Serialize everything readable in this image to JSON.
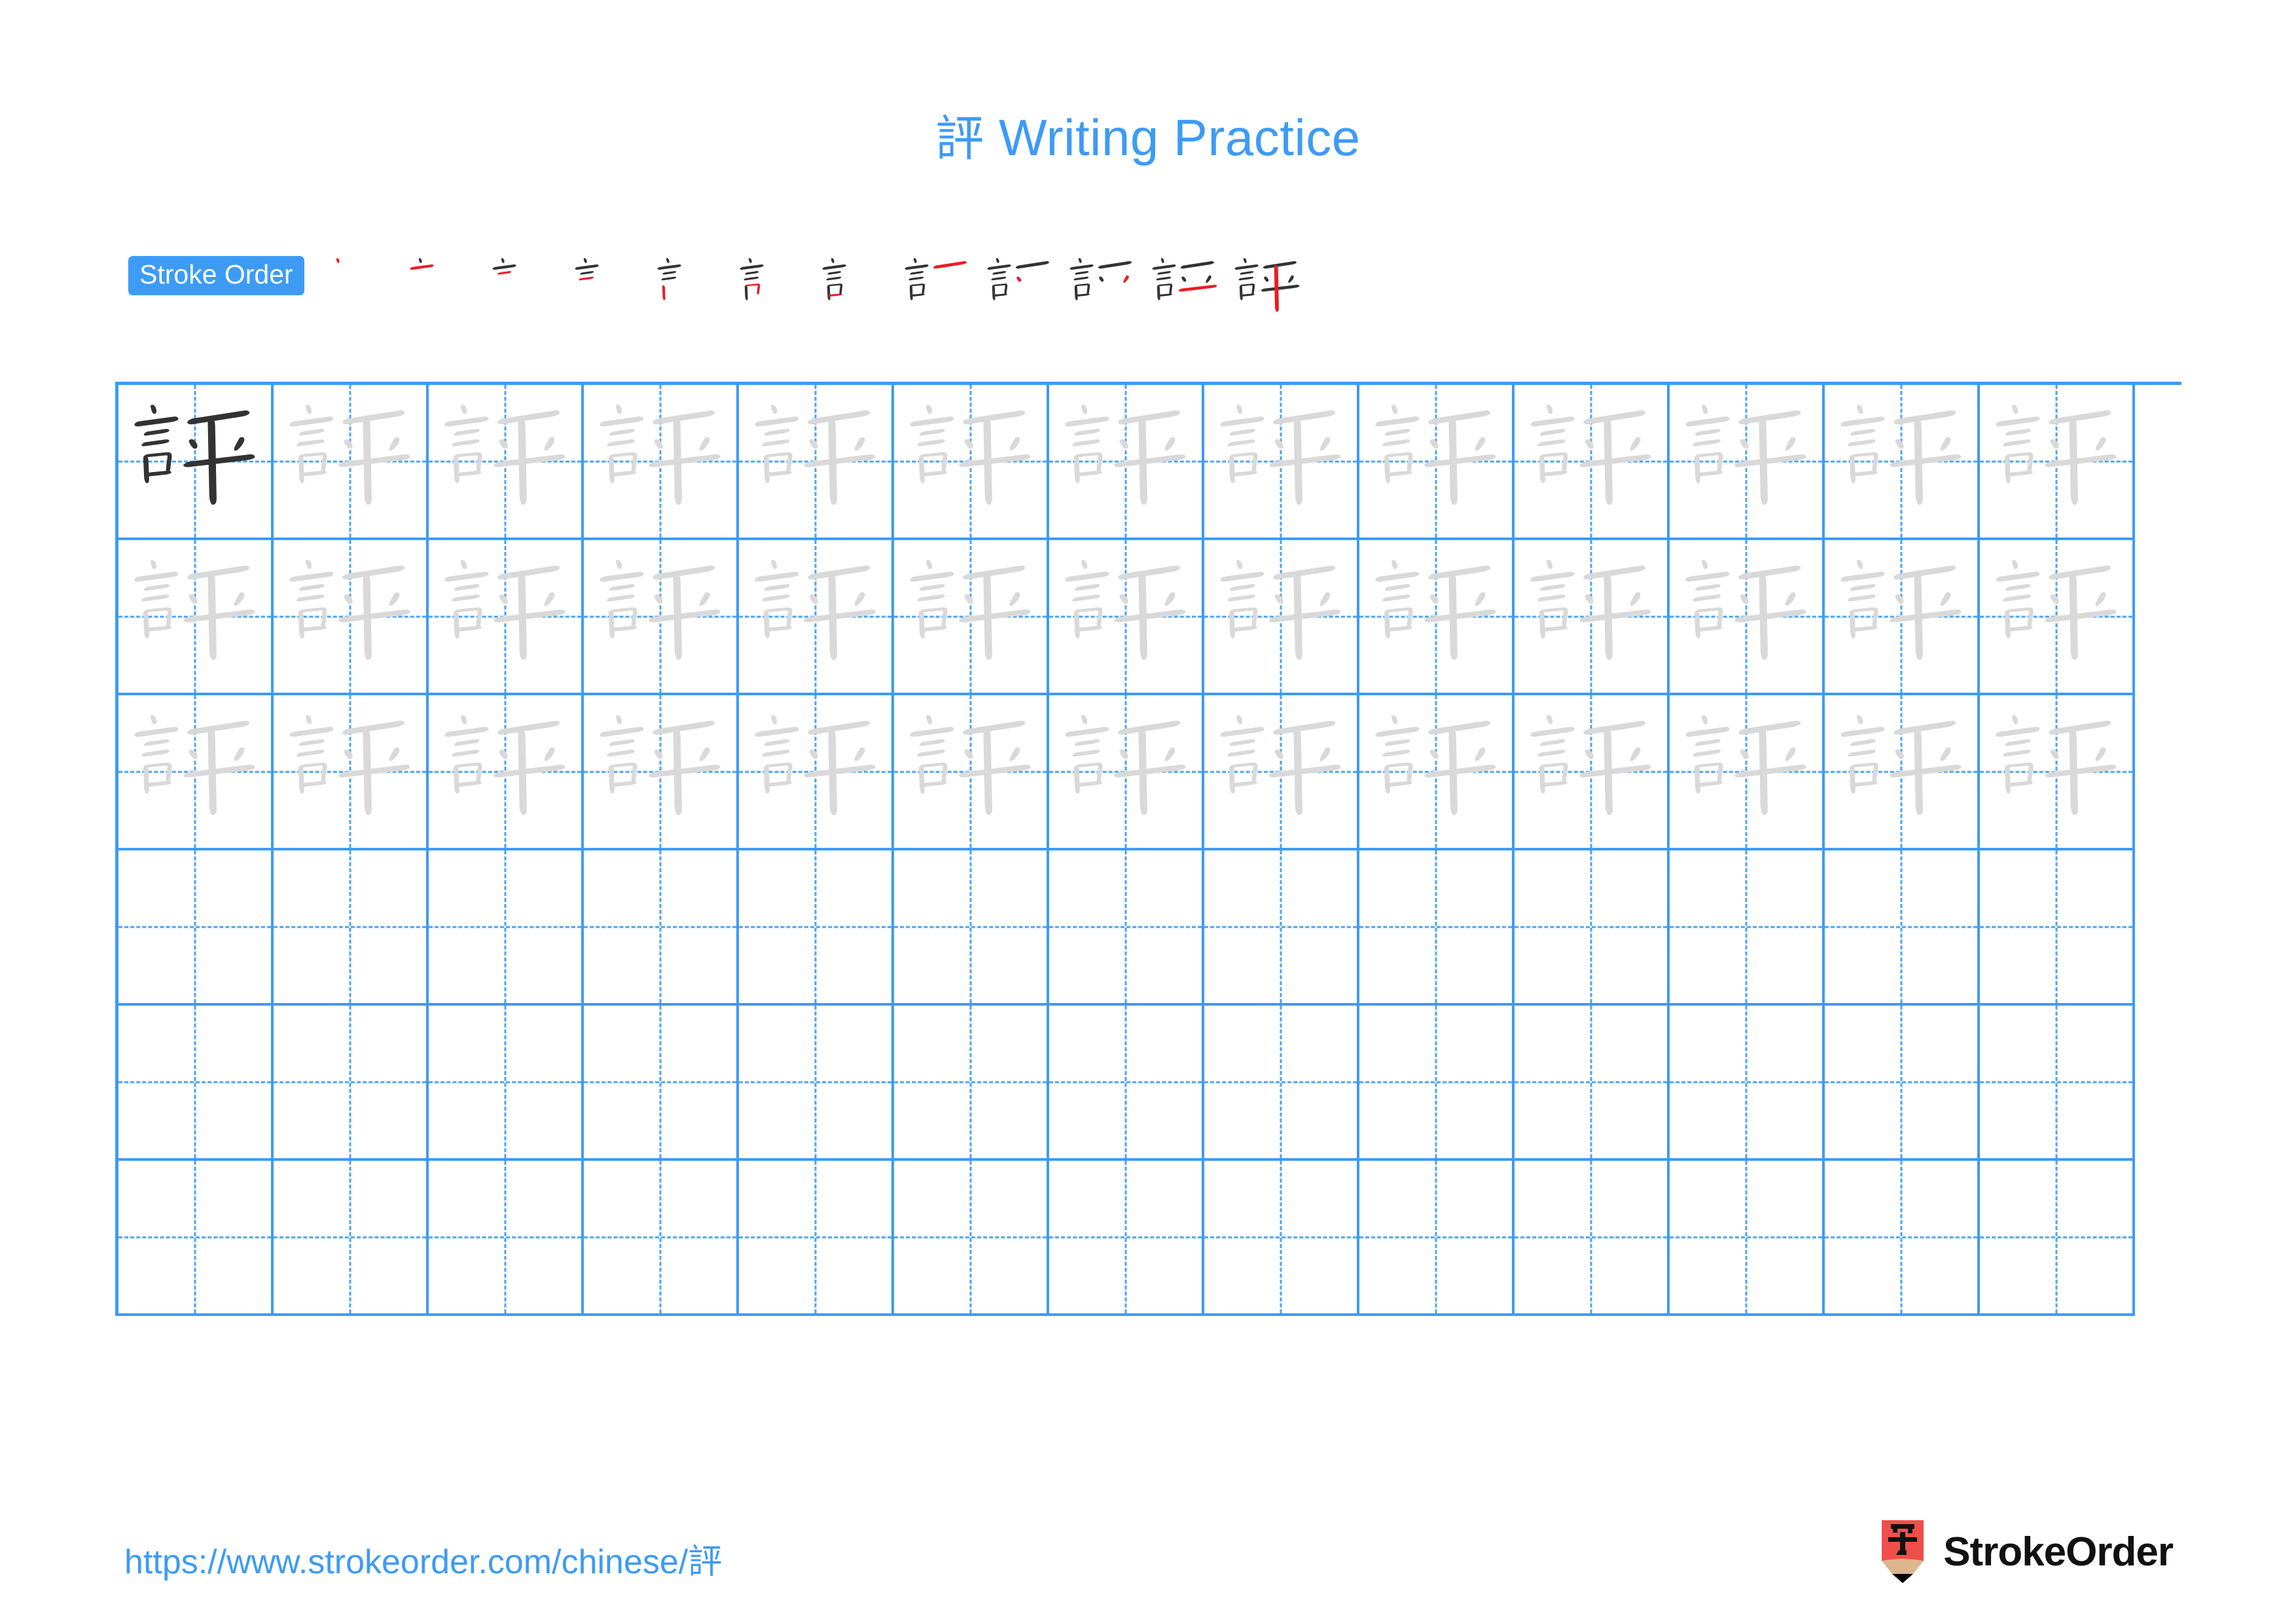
{
  "character": "評",
  "title": {
    "char": "評",
    "suffix": " Writing Practice",
    "full": "評 Writing Practice",
    "color": "#3d9bf5"
  },
  "stroke_order": {
    "badge_label": "Stroke Order",
    "badge_bg": "#3d9bf5",
    "badge_text_color": "#ffffff",
    "total_strokes": 12,
    "new_stroke_color": "#ec1c24",
    "done_stroke_color": "#333333",
    "steps": [
      {
        "index": 1,
        "strokes_drawn": 1,
        "new_stroke": 1,
        "partial": "丶"
      },
      {
        "index": 2,
        "strokes_drawn": 2,
        "new_stroke": 2,
        "partial": "二"
      },
      {
        "index": 3,
        "strokes_drawn": 3,
        "new_stroke": 3,
        "partial": "三"
      },
      {
        "index": 4,
        "strokes_drawn": 4,
        "new_stroke": 4,
        "partial": "亖"
      },
      {
        "index": 5,
        "strokes_drawn": 5,
        "new_stroke": 5,
        "partial": "訁"
      },
      {
        "index": 6,
        "strokes_drawn": 6,
        "new_stroke": 6,
        "partial": "訁"
      },
      {
        "index": 7,
        "strokes_drawn": 7,
        "new_stroke": 7,
        "partial": "言"
      },
      {
        "index": 8,
        "strokes_drawn": 8,
        "new_stroke": 8,
        "partial": "言一"
      },
      {
        "index": 9,
        "strokes_drawn": 9,
        "new_stroke": 9,
        "partial": "言丷"
      },
      {
        "index": 10,
        "strokes_drawn": 10,
        "new_stroke": 10,
        "partial": "言丷"
      },
      {
        "index": 11,
        "strokes_drawn": 11,
        "new_stroke": 11,
        "partial": "評"
      },
      {
        "index": 12,
        "strokes_drawn": 12,
        "new_stroke": 12,
        "partial": "評"
      }
    ]
  },
  "grid": {
    "columns": 13,
    "rows": 6,
    "filled_rows": 3,
    "blank_rows": 3,
    "line_color": "#3d9bf5",
    "guide_color": "#4aa3f7",
    "model_char_color": "#333333",
    "trace_char_color": "#d9d9d9",
    "cells": [
      [
        "model",
        "trace",
        "trace",
        "trace",
        "trace",
        "trace",
        "trace",
        "trace",
        "trace",
        "trace",
        "trace",
        "trace",
        "trace"
      ],
      [
        "trace",
        "trace",
        "trace",
        "trace",
        "trace",
        "trace",
        "trace",
        "trace",
        "trace",
        "trace",
        "trace",
        "trace",
        "trace"
      ],
      [
        "trace",
        "trace",
        "trace",
        "trace",
        "trace",
        "trace",
        "trace",
        "trace",
        "trace",
        "trace",
        "trace",
        "trace",
        "trace"
      ],
      [
        "empty",
        "empty",
        "empty",
        "empty",
        "empty",
        "empty",
        "empty",
        "empty",
        "empty",
        "empty",
        "empty",
        "empty",
        "empty"
      ],
      [
        "empty",
        "empty",
        "empty",
        "empty",
        "empty",
        "empty",
        "empty",
        "empty",
        "empty",
        "empty",
        "empty",
        "empty",
        "empty"
      ],
      [
        "empty",
        "empty",
        "empty",
        "empty",
        "empty",
        "empty",
        "empty",
        "empty",
        "empty",
        "empty",
        "empty",
        "empty",
        "empty"
      ]
    ]
  },
  "footer": {
    "url_prefix": "https://www.strokeorder.com/chinese/",
    "url_char": "評",
    "url_full": "https://www.strokeorder.com/chinese/評",
    "url_color": "#3d9bf5",
    "brand_name": "StrokeOrder",
    "brand_mark_char": "字",
    "brand_mark_color": "#ef4f4b",
    "brand_mark_tip_color": "#dcb68e",
    "brand_mark_point_color": "#000000"
  }
}
